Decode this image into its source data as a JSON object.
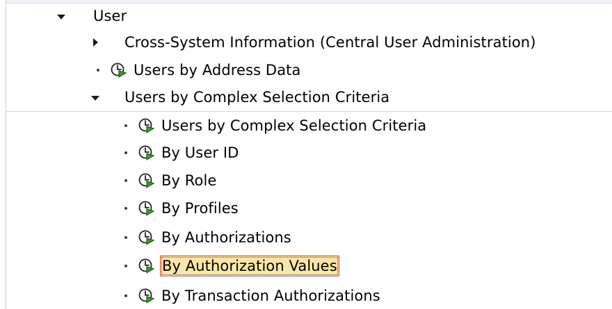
{
  "tree": {
    "root": {
      "label": "User",
      "expanded": true,
      "children": [
        {
          "label": "Cross-System Information (Central User Administration)",
          "type": "folder",
          "expanded": false
        },
        {
          "label": "Users by Address Data",
          "type": "transaction"
        },
        {
          "label": "Users by Complex Selection Criteria",
          "type": "folder",
          "expanded": true,
          "children": [
            {
              "label": "Users by Complex Selection Criteria",
              "type": "transaction"
            },
            {
              "label": "By User ID",
              "type": "transaction"
            },
            {
              "label": "By Role",
              "type": "transaction"
            },
            {
              "label": "By Profiles",
              "type": "transaction"
            },
            {
              "label": "By Authorizations",
              "type": "transaction"
            },
            {
              "label": "By Authorization Values",
              "type": "transaction",
              "selected": true
            },
            {
              "label": "By Transaction Authorizations",
              "type": "transaction"
            }
          ]
        }
      ]
    }
  },
  "icons": {
    "expand": "triangle-down-icon",
    "collapse": "triangle-right-icon",
    "transaction": "execute-clock-icon",
    "leaf": "bullet-icon"
  },
  "colors": {
    "selection_bg": "#f8e7a6",
    "selection_border": "#e34242",
    "icon_green": "#3c9c2b"
  }
}
